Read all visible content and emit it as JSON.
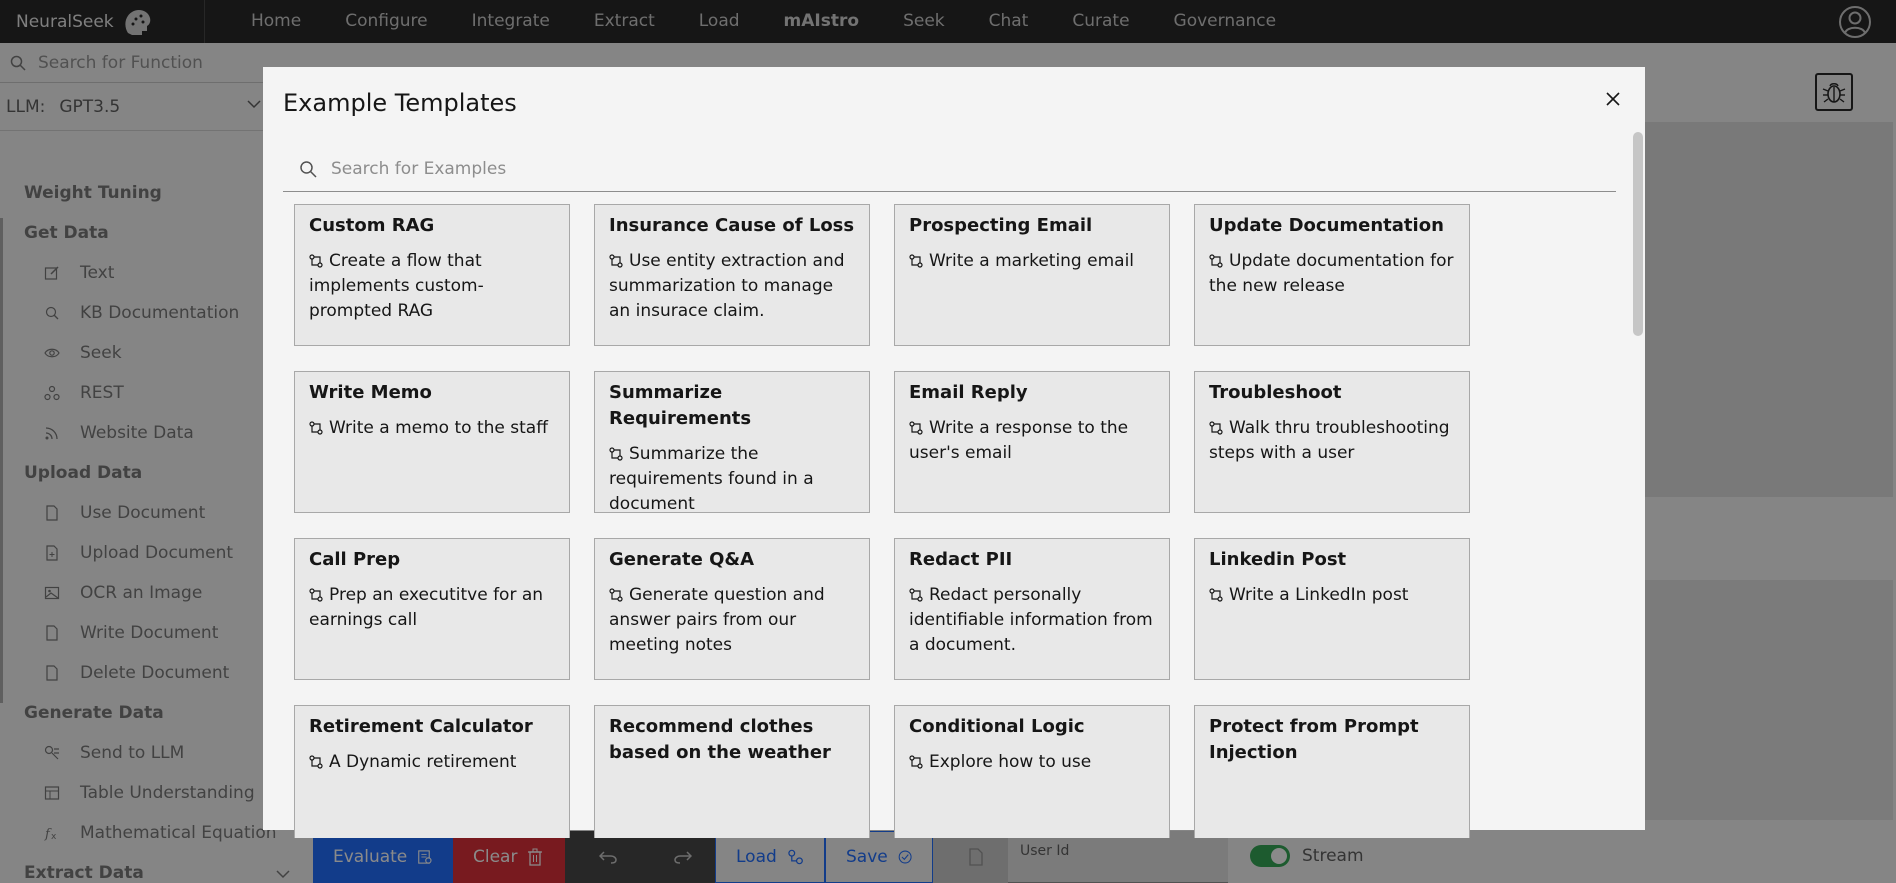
{
  "app": {
    "brand": "NeuralSeek",
    "nav": [
      "Home",
      "Configure",
      "Integrate",
      "Extract",
      "Load",
      "mAIstro",
      "Seek",
      "Chat",
      "Curate",
      "Governance"
    ]
  },
  "sidebar": {
    "search_placeholder": "Search for Function",
    "llm_label": "LLM:",
    "llm_value": "GPT3.5",
    "groups": [
      {
        "label": "Weight Tuning",
        "items": []
      },
      {
        "label": "Get Data",
        "items": [
          {
            "label": "Text",
            "icon": "edit-icon"
          },
          {
            "label": "KB Documentation",
            "icon": "doc-search-icon"
          },
          {
            "label": "Seek",
            "icon": "eye-icon"
          },
          {
            "label": "REST",
            "icon": "api-icon"
          },
          {
            "label": "Website Data",
            "icon": "rss-icon"
          }
        ]
      },
      {
        "label": "Upload Data",
        "items": [
          {
            "label": "Use Document",
            "icon": "document-icon"
          },
          {
            "label": "Upload Document",
            "icon": "document-add-icon"
          },
          {
            "label": "OCR an Image",
            "icon": "image-icon"
          },
          {
            "label": "Write Document",
            "icon": "document-icon"
          },
          {
            "label": "Delete Document",
            "icon": "document-icon"
          }
        ]
      },
      {
        "label": "Generate Data",
        "items": [
          {
            "label": "Send to LLM",
            "icon": "llm-icon"
          },
          {
            "label": "Table Understanding",
            "icon": "table-icon"
          },
          {
            "label": "Mathematical Equation",
            "icon": "function-icon"
          }
        ]
      },
      {
        "label": "Extract Data",
        "items": []
      }
    ]
  },
  "toolbar": {
    "evaluate": "Evaluate",
    "clear": "Clear",
    "load": "Load",
    "save": "Save",
    "user_id_label": "User Id",
    "stream_label": "Stream"
  },
  "modal": {
    "title": "Example Templates",
    "search_placeholder": "Search for Examples",
    "cards": [
      {
        "title": "Custom RAG",
        "desc": "Create a flow that implements custom-prompted RAG"
      },
      {
        "title": "Insurance Cause of Loss",
        "desc": "Use entity extraction and summarization to manage an insurace claim."
      },
      {
        "title": "Prospecting Email",
        "desc": "Write a marketing email"
      },
      {
        "title": "Update Documentation",
        "desc": "Update documentation for the new release"
      },
      {
        "title": "Write Memo",
        "desc": "Write a memo to the staff"
      },
      {
        "title": "Summarize Requirements",
        "desc": "Summarize the requirements found in a document"
      },
      {
        "title": "Email Reply",
        "desc": "Write a response to the user's email"
      },
      {
        "title": "Troubleshoot",
        "desc": "Walk thru troubleshooting steps with a user"
      },
      {
        "title": "Call Prep",
        "desc": "Prep an executitve for an earnings call"
      },
      {
        "title": "Generate Q&A",
        "desc": "Generate question and answer pairs from our meeting notes"
      },
      {
        "title": "Redact PII",
        "desc": "Redact personally identifiable information from a document."
      },
      {
        "title": "Linkedin Post",
        "desc": "Write a LinkedIn post"
      },
      {
        "title": "Retirement Calculator",
        "desc": "A Dynamic retirement"
      },
      {
        "title": "Recommend clothes based on the weather",
        "desc": ""
      },
      {
        "title": "Conditional Logic",
        "desc": "Explore how to use"
      },
      {
        "title": "Protect from Prompt Injection",
        "desc": ""
      }
    ]
  }
}
